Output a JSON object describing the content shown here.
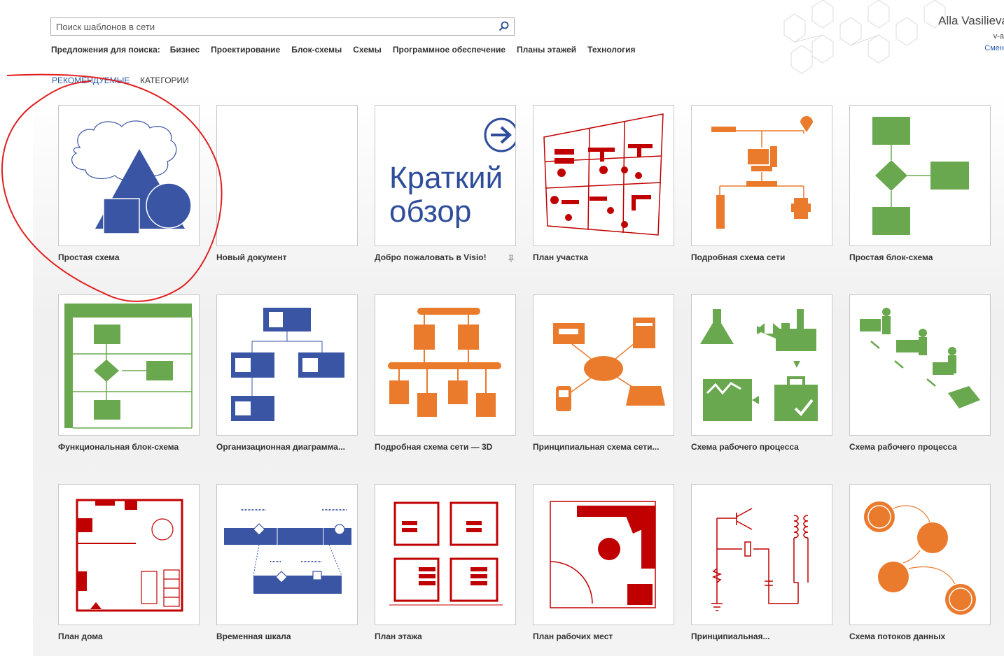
{
  "search": {
    "placeholder": "Поиск шаблонов в сети"
  },
  "suggestions": {
    "label": "Предложения для поиска:",
    "items": [
      "Бизнес",
      "Проектирование",
      "Блок-схемы",
      "Схемы",
      "Программное обеспечение",
      "Планы этажей",
      "Технология"
    ]
  },
  "user": {
    "name": "Alla Vasilieva",
    "email": "v-a",
    "switch": "Смен"
  },
  "tabs": {
    "featured": "РЕКОМЕНДУЕМЫЕ",
    "categories": "КАТЕГОРИИ"
  },
  "colors": {
    "blue": "#3a55a4",
    "green": "#6aa84f",
    "orange": "#ea7a2c",
    "red": "#c00000",
    "annotation": "#e02020"
  },
  "templates": [
    {
      "label": "Простая схема",
      "icon": "basic-shapes-thumbnail"
    },
    {
      "label": "Новый документ",
      "icon": "blank-document-thumbnail"
    },
    {
      "label": "Добро пожаловать в Visio!",
      "icon": "tour-thumbnail",
      "tour_text_1": "Краткий",
      "tour_text_2": "обзор"
    },
    {
      "label": "План участка",
      "icon": "site-plan-thumbnail"
    },
    {
      "label": "Подробная схема сети",
      "icon": "network-thumbnail"
    },
    {
      "label": "Простая блок-схема",
      "icon": "flowchart-thumbnail"
    },
    {
      "label": "Функциональная блок-схема",
      "icon": "cross-functional-thumbnail"
    },
    {
      "label": "Организационная диаграмма...",
      "icon": "org-chart-thumbnail"
    },
    {
      "label": "Подробная схема сети — 3D",
      "icon": "network-3d-thumbnail"
    },
    {
      "label": "Принципиальная схема сети...",
      "icon": "basic-network-thumbnail"
    },
    {
      "label": "Схема рабочего процесса",
      "icon": "workflow-thumbnail"
    },
    {
      "label": "Схема рабочего процесса",
      "icon": "workflow-3d-thumbnail"
    },
    {
      "label": "План дома",
      "icon": "home-plan-thumbnail"
    },
    {
      "label": "Временная шкала",
      "icon": "timeline-thumbnail"
    },
    {
      "label": "План этажа",
      "icon": "floor-plan-thumbnail"
    },
    {
      "label": "План рабочих мест",
      "icon": "office-layout-thumbnail"
    },
    {
      "label": "Принципиальная...",
      "icon": "circuit-thumbnail"
    },
    {
      "label": "Схема потоков данных",
      "icon": "data-flow-thumbnail"
    }
  ]
}
